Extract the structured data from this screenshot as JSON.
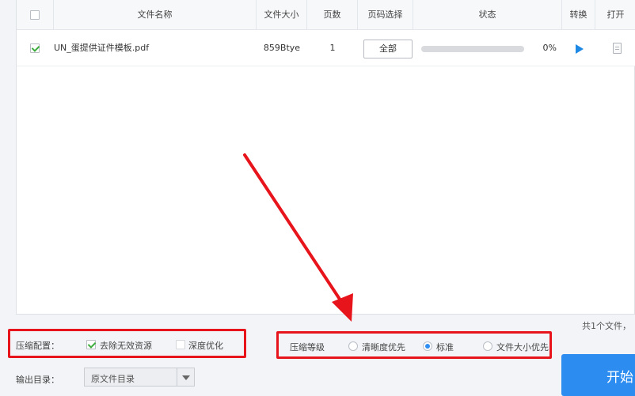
{
  "table": {
    "headers": {
      "filename": "文件名称",
      "filesize": "文件大小",
      "pages": "页数",
      "page_select": "页码选择",
      "status": "状态",
      "convert": "转换",
      "open": "打开"
    },
    "rows": [
      {
        "checked": true,
        "filename": "UN_蛋提供证件模板.pdf",
        "filesize": "859Btye",
        "pages": "1",
        "page_select_button": "全部",
        "progress": 0,
        "progress_text": "0%"
      }
    ]
  },
  "file_count": "共1个文件，",
  "compression_config": {
    "label": "压缩配置：",
    "options": [
      {
        "label": "去除无效资源",
        "checked": true
      },
      {
        "label": "深度优化",
        "checked": false
      }
    ]
  },
  "compression_level": {
    "label": "压缩等级",
    "options": [
      {
        "label": "清晰度优先",
        "selected": false
      },
      {
        "label": "标准",
        "selected": true
      },
      {
        "label": "文件大小优先",
        "selected": false
      }
    ]
  },
  "output_dir": {
    "label": "输出目录：",
    "value": "原文件目录"
  },
  "start_button": "开始",
  "colors": {
    "accent": "#2d8cf0",
    "highlight_box": "#e8141c",
    "check": "#3cac3c"
  },
  "icons": [
    "checkbox-icon",
    "play-icon",
    "document-icon",
    "chevron-down-icon",
    "annotation-arrow"
  ]
}
